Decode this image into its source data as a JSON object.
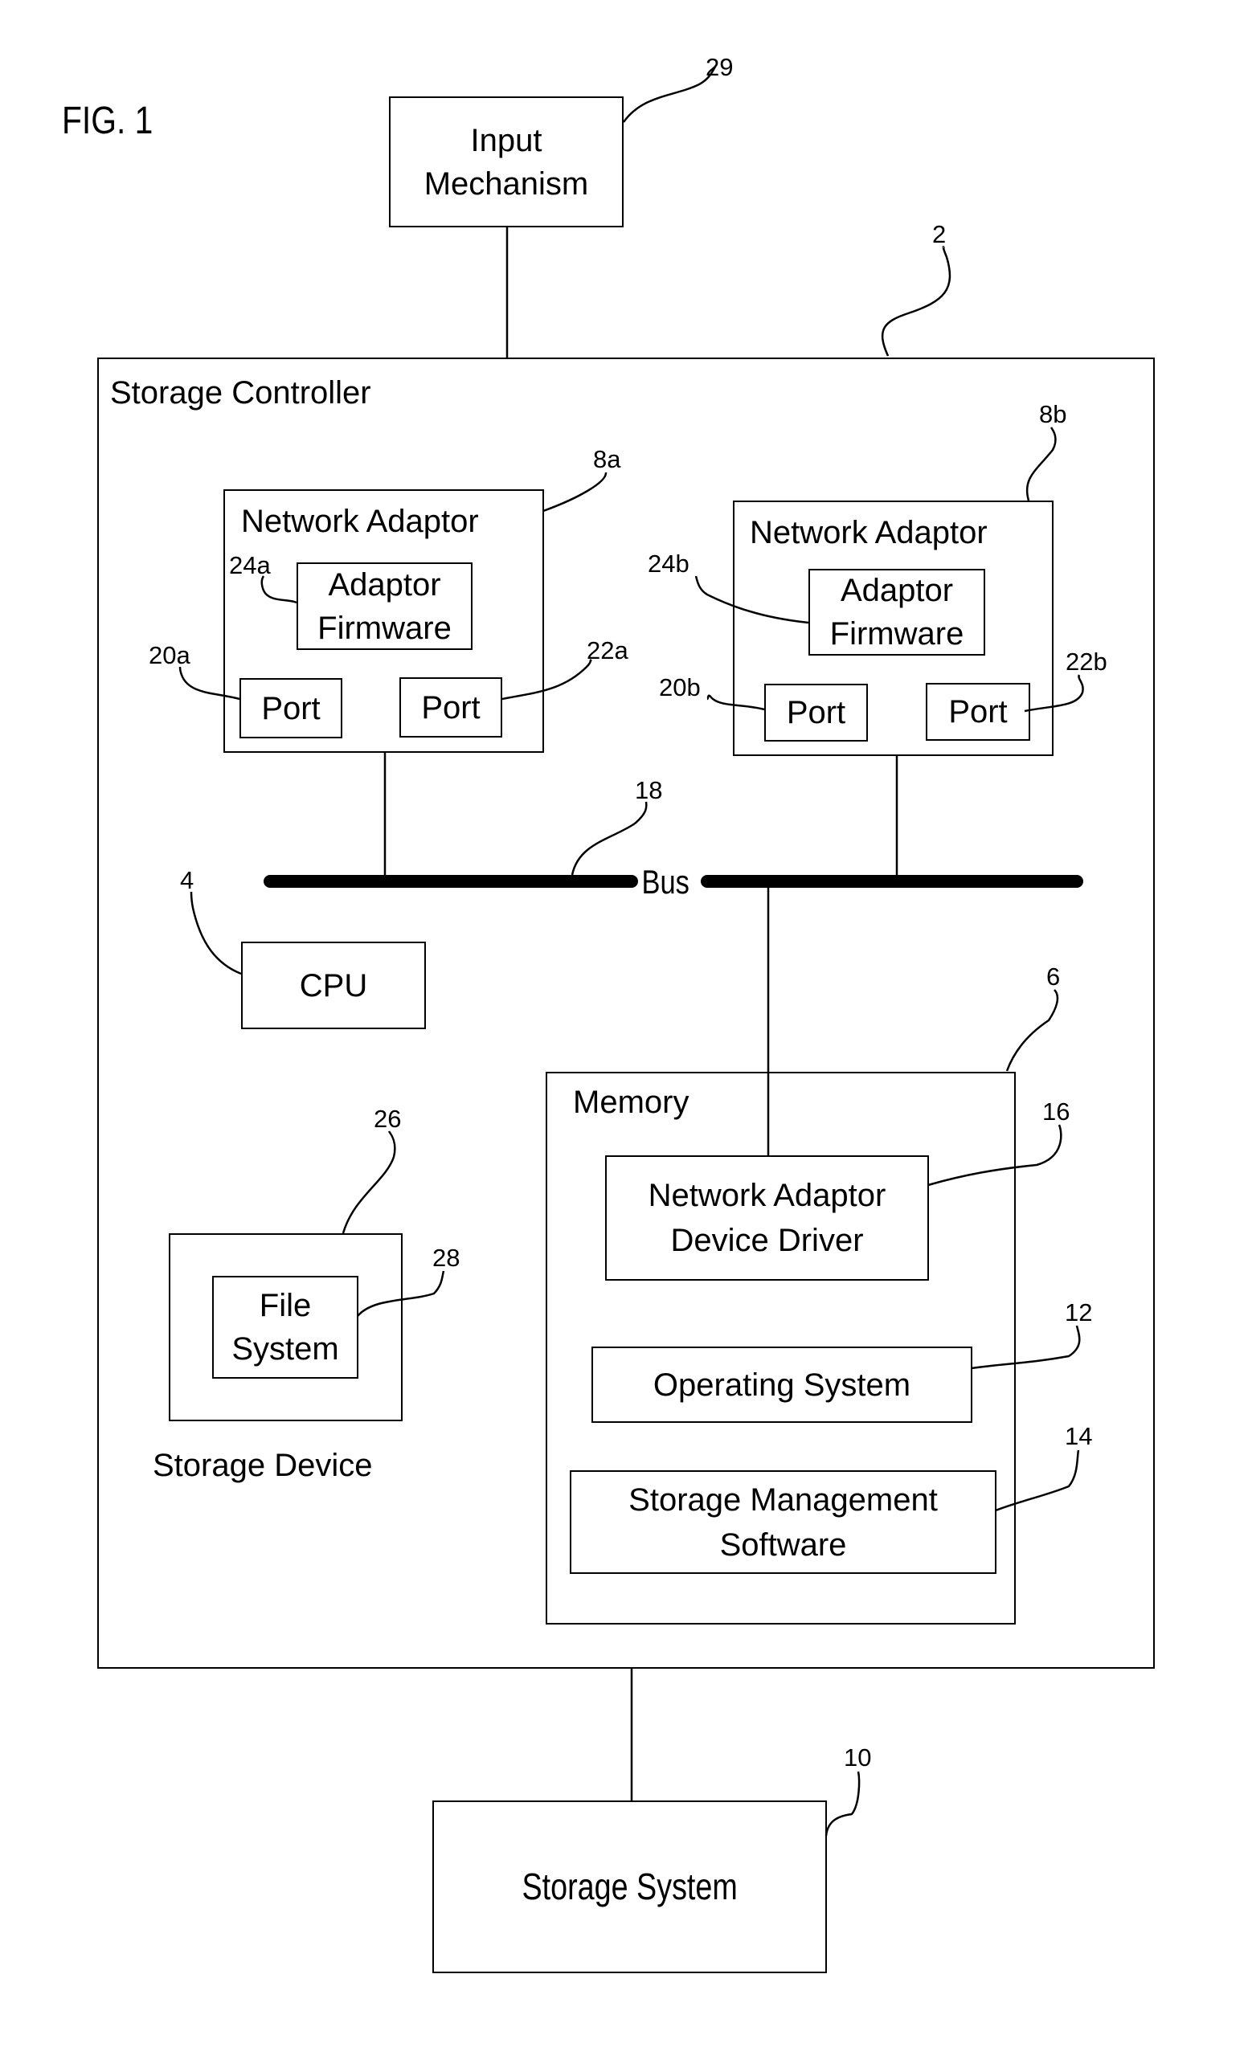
{
  "figure": {
    "title": "FIG. 1"
  },
  "blocks": {
    "input_mechanism": {
      "label_line1": "Input",
      "label_line2": "Mechanism",
      "ref": "29"
    },
    "storage_controller": {
      "label": "Storage Controller",
      "ref": "2"
    },
    "network_adaptor_a": {
      "label": "Network Adaptor",
      "ref": "8a",
      "firmware": {
        "label_line1": "Adaptor",
        "label_line2": "Firmware",
        "ref": "24a"
      },
      "port_left": {
        "label": "Port",
        "ref": "20a"
      },
      "port_right": {
        "label": "Port",
        "ref": "22a"
      }
    },
    "network_adaptor_b": {
      "label": "Network Adaptor",
      "ref": "8b",
      "firmware": {
        "label_line1": "Adaptor",
        "label_line2": "Firmware",
        "ref": "24b"
      },
      "port_left": {
        "label": "Port",
        "ref": "20b"
      },
      "port_right": {
        "label": "Port",
        "ref": "22b"
      }
    },
    "bus": {
      "label": "Bus",
      "ref": "18"
    },
    "cpu": {
      "label": "CPU",
      "ref": "4"
    },
    "storage_device": {
      "label": "Storage Device",
      "ref": "26",
      "file_system": {
        "label_line1": "File",
        "label_line2": "System",
        "ref": "28"
      }
    },
    "memory": {
      "label": "Memory",
      "ref": "6",
      "device_driver": {
        "label_line1": "Network Adaptor",
        "label_line2": "Device Driver",
        "ref": "16"
      },
      "operating_system": {
        "label": "Operating System",
        "ref": "12"
      },
      "storage_management": {
        "label_line1": "Storage Management",
        "label_line2": "Software",
        "ref": "14"
      }
    },
    "storage_system": {
      "label": "Storage System",
      "ref": "10"
    }
  }
}
